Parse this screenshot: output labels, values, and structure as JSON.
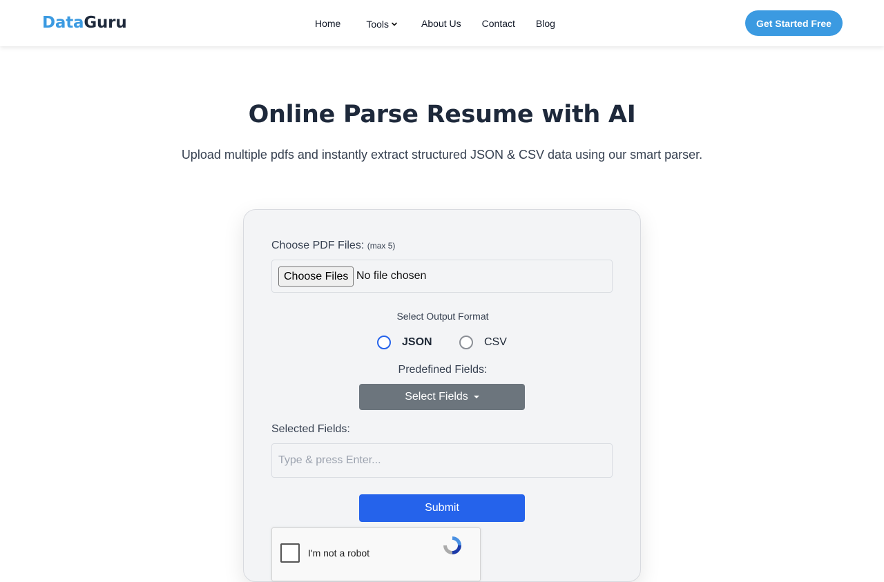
{
  "brand": {
    "part1": "Data",
    "part2": "Guru"
  },
  "nav": {
    "home": "Home",
    "tools": "Tools",
    "about": "About Us",
    "contact": "Contact",
    "blog": "Blog"
  },
  "cta_label": "Get Started Free",
  "hero": {
    "title": "Online Parse Resume with AI",
    "subtitle": "Upload multiple pdfs and instantly extract structured JSON & CSV data using our smart parser."
  },
  "form": {
    "file_label": "Choose PDF Files:",
    "file_hint": "(max 5)",
    "file_button": "Choose Files",
    "file_status": "No file chosen",
    "format_title": "Select Output Format",
    "formats": {
      "json": "JSON",
      "csv": "CSV"
    },
    "predefined_label": "Predefined Fields:",
    "select_fields_button": "Select Fields",
    "selected_fields_label": "Selected Fields:",
    "selected_fields_placeholder": "Type & press Enter...",
    "submit_label": "Submit",
    "captcha_text": "I'm not a robot"
  },
  "colors": {
    "brand_blue": "#3b9ae1",
    "primary_blue": "#2563eb",
    "secondary_gray": "#6c757d"
  }
}
